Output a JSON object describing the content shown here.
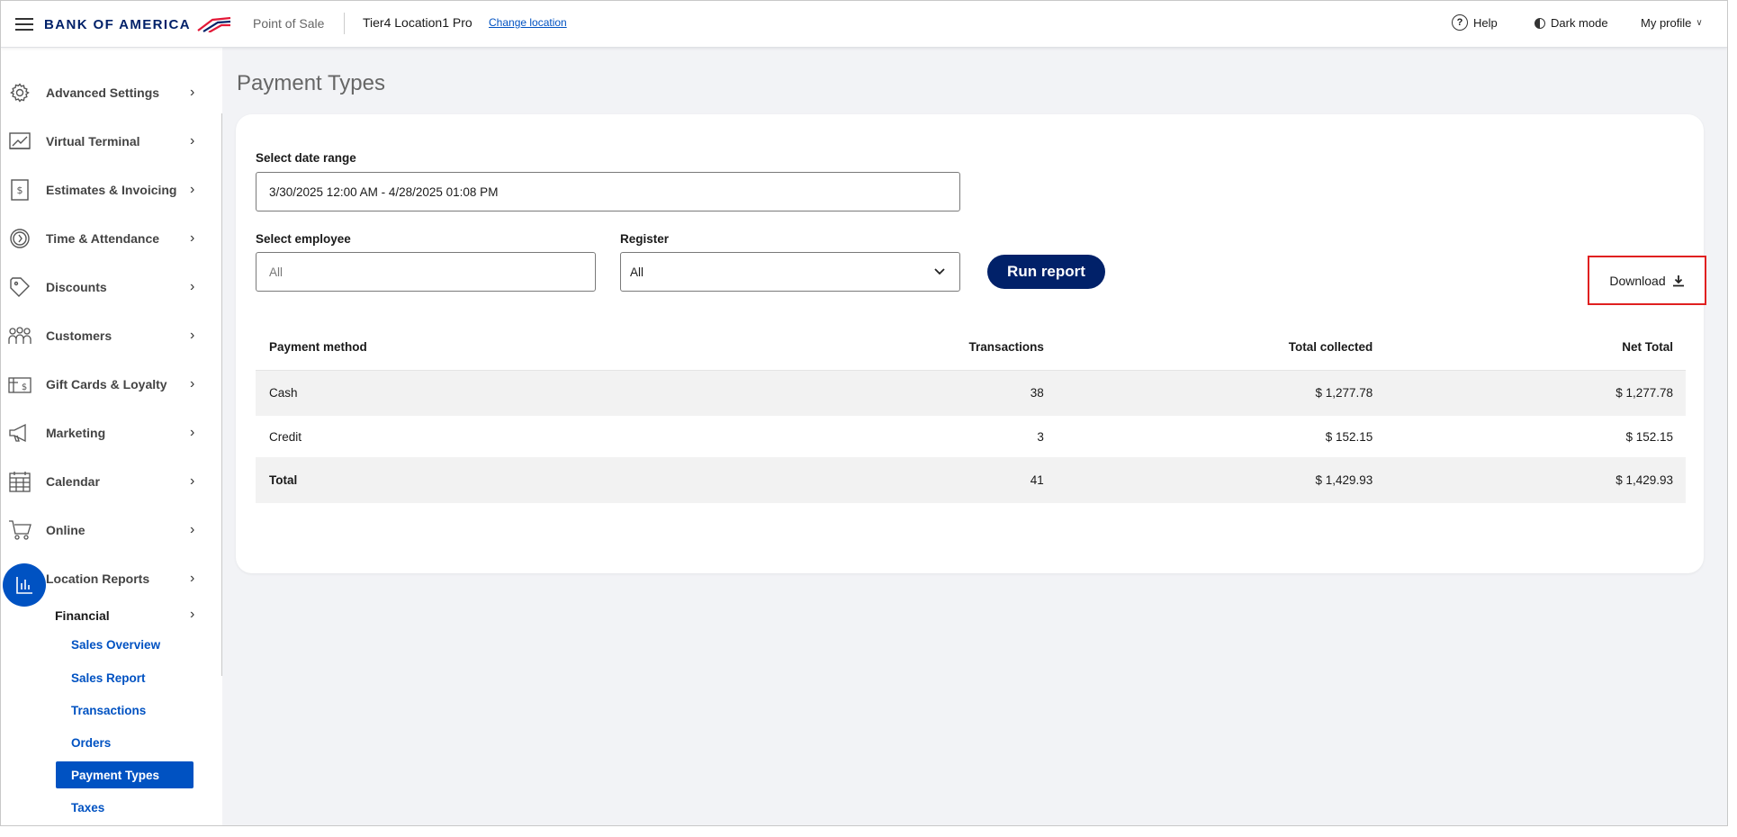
{
  "header": {
    "brand": "BANK OF AMERICA",
    "app_label": "Point of Sale",
    "location_name": "Tier4 Location1 Pro",
    "change_location": "Change location",
    "help": "Help",
    "dark_mode": "Dark mode",
    "profile": "My profile"
  },
  "sidebar": {
    "items": [
      {
        "label": "Advanced Settings",
        "icon": "gear-icon"
      },
      {
        "label": "Virtual Terminal",
        "icon": "terminal-icon"
      },
      {
        "label": "Estimates & Invoicing",
        "icon": "invoice-icon"
      },
      {
        "label": "Time & Attendance",
        "icon": "clock-icon"
      },
      {
        "label": "Discounts",
        "icon": "tag-icon"
      },
      {
        "label": "Customers",
        "icon": "people-icon"
      },
      {
        "label": "Gift Cards & Loyalty",
        "icon": "gift-card-icon"
      },
      {
        "label": "Marketing",
        "icon": "megaphone-icon"
      },
      {
        "label": "Calendar",
        "icon": "calendar-icon"
      },
      {
        "label": "Online",
        "icon": "cart-icon"
      },
      {
        "label": "Location Reports",
        "icon": "bar-chart-icon"
      }
    ],
    "financial_label": "Financial",
    "sub_items": [
      {
        "label": "Sales Overview"
      },
      {
        "label": "Sales Report"
      },
      {
        "label": "Transactions"
      },
      {
        "label": "Orders"
      },
      {
        "label": "Payment Types"
      },
      {
        "label": "Taxes"
      }
    ],
    "active_sub_item": "Payment Types"
  },
  "main": {
    "title": "Payment Types",
    "date_range_label": "Select date range",
    "date_range_value": "3/30/2025 12:00 AM - 4/28/2025 01:08 PM",
    "employee_label": "Select employee",
    "employee_placeholder": "All",
    "register_label": "Register",
    "register_value": "All",
    "run_report": "Run report",
    "download": "Download"
  },
  "table": {
    "columns": [
      "Payment method",
      "Transactions",
      "Total collected",
      "Net Total"
    ],
    "rows": [
      {
        "method": "Cash",
        "transactions": "38",
        "total_collected": "$ 1,277.78",
        "net_total": "$ 1,277.78"
      },
      {
        "method": "Credit",
        "transactions": "3",
        "total_collected": "$ 152.15",
        "net_total": "$ 152.15"
      }
    ],
    "total": {
      "method": "Total",
      "transactions": "41",
      "total_collected": "$ 1,429.93",
      "net_total": "$ 1,429.93"
    }
  },
  "colors": {
    "brand_navy": "#012169",
    "accent_blue": "#0052c2",
    "highlight_red": "#e02020"
  }
}
